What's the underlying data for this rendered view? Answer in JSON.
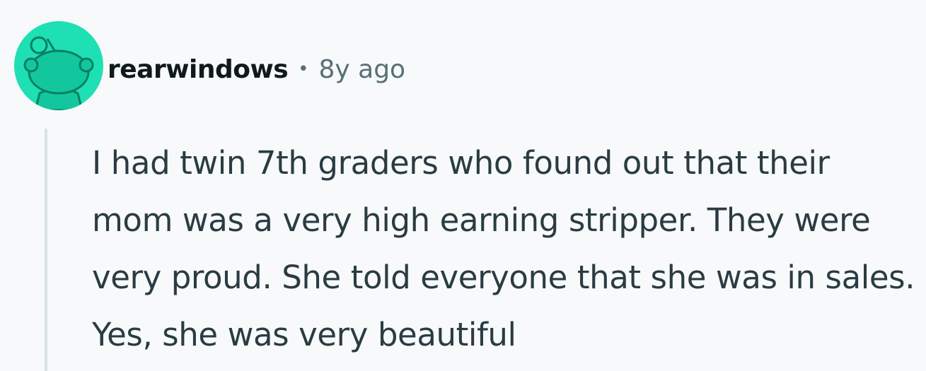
{
  "comment": {
    "avatar_icon": "snoo-avatar-icon",
    "avatar_color": "#1ee0b4",
    "author": "rearwindows",
    "separator": "•",
    "timestamp": "8y ago",
    "body": "I had twin 7th graders who found out that their mom was a very high earning stripper. They were very proud. She told everyone that she was in sales. Yes, she was very beautiful"
  }
}
